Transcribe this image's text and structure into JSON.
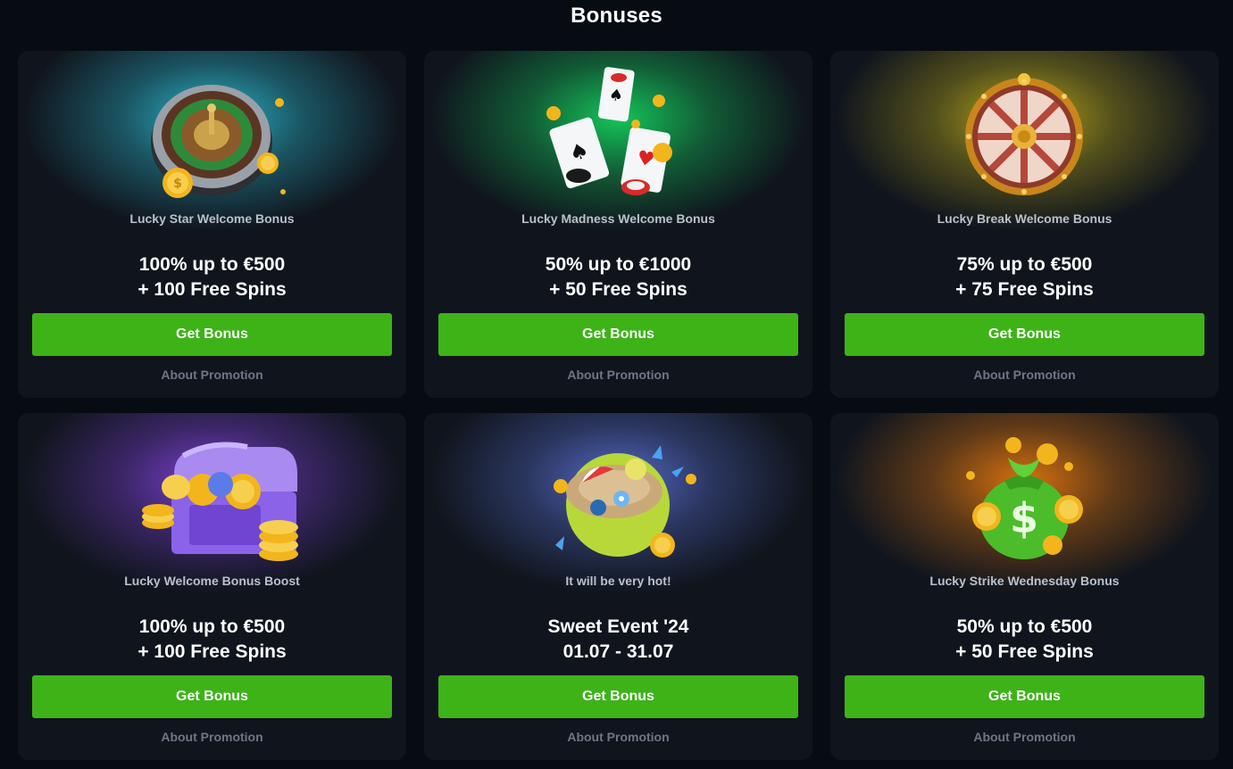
{
  "page": {
    "title": "Bonuses"
  },
  "cards": [
    {
      "subtitle": "Lucky Star Welcome Bonus",
      "offer_line1": "100% up to €500",
      "offer_line2": "+ 100 Free Spins",
      "button_label": "Get Bonus",
      "link_label": "About Promotion",
      "glow_color": "#2bb3c9",
      "icon": "roulette-wheel-icon"
    },
    {
      "subtitle": "Lucky Madness Welcome Bonus",
      "offer_line1": "50% up to €1000",
      "offer_line2": "+ 50 Free Spins",
      "button_label": "Get Bonus",
      "link_label": "About Promotion",
      "glow_color": "#14c45a",
      "icon": "playing-cards-icon"
    },
    {
      "subtitle": "Lucky Break Welcome Bonus",
      "offer_line1": "75% up to €500",
      "offer_line2": "+ 75 Free Spins",
      "button_label": "Get Bonus",
      "link_label": "About Promotion",
      "glow_color": "#b5a51a",
      "icon": "prize-wheel-icon"
    },
    {
      "subtitle": "Lucky Welcome Bonus Boost",
      "offer_line1": "100% up to €500",
      "offer_line2": "+ 100 Free Spins",
      "button_label": "Get Bonus",
      "link_label": "About Promotion",
      "glow_color": "#7a3fd1",
      "icon": "treasure-chest-icon"
    },
    {
      "subtitle": "It will be very hot!",
      "offer_line1": "Sweet Event '24",
      "offer_line2": "01.07 - 31.07",
      "button_label": "Get Bonus",
      "link_label": "About Promotion",
      "glow_color": "#5468c4",
      "icon": "summer-island-icon"
    },
    {
      "subtitle": "Lucky Strike Wednesday Bonus",
      "offer_line1": "50% up to €500",
      "offer_line2": "+ 50 Free Spins",
      "button_label": "Get Bonus",
      "link_label": "About Promotion",
      "glow_color": "#d6700f",
      "icon": "money-bag-icon"
    }
  ]
}
